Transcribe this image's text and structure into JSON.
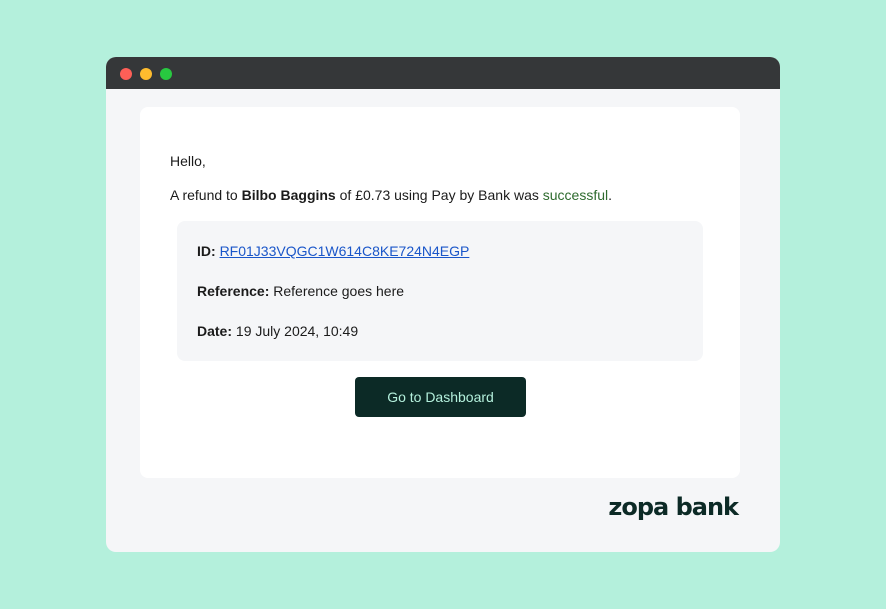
{
  "colors": {
    "page_background": "#b4f0dc",
    "titlebar": "#353739",
    "window_background": "#f5f6f8",
    "card_background": "#ffffff",
    "button_background": "#0c2a26",
    "button_text": "#b4f0dc",
    "link": "#1a56c9",
    "success_text": "#2e6b2e",
    "logo": "#0c2a26"
  },
  "window": {
    "controls": [
      "close-dot",
      "minimize-dot",
      "maximize-dot"
    ]
  },
  "email": {
    "greeting": "Hello,",
    "message": {
      "prefix": "A refund to ",
      "recipient": "Bilbo Baggins",
      "middle": " of £0.73 using Pay by Bank was ",
      "status": "successful",
      "suffix": "."
    },
    "details": {
      "id_label": "ID:",
      "id_value": "RF01J33VQGC1W614C8KE724N4EGP",
      "reference_label": "Reference:",
      "reference_value": "Reference goes here",
      "date_label": "Date:",
      "date_value": "19 July 2024, 10:49"
    },
    "cta_label": "Go to Dashboard"
  },
  "brand": {
    "logo_text": "zopa bank"
  }
}
